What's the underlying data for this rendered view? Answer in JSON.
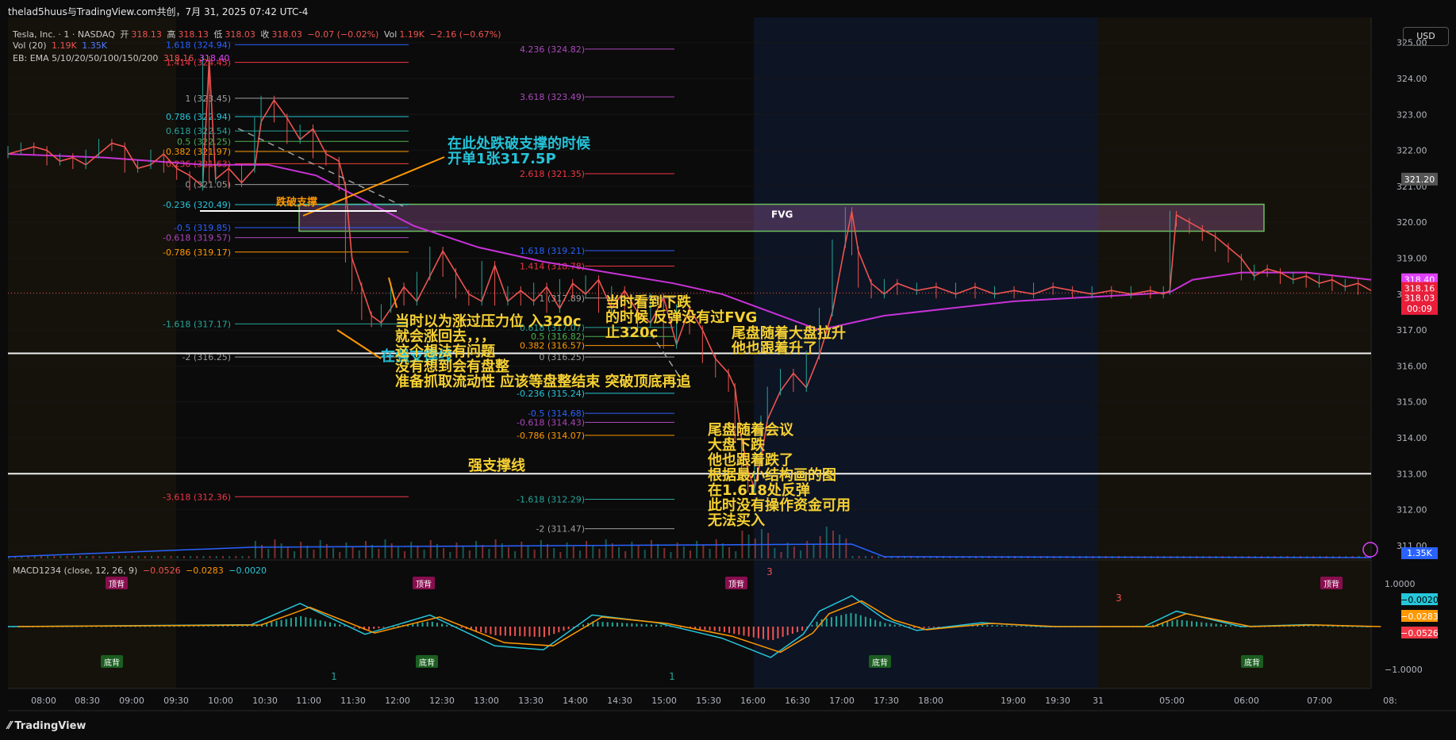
{
  "header": {
    "title": "thelad5huus与TradingView.com共创，7月 31, 2025 07:42 UTC-4"
  },
  "legend": {
    "symbol": "Tesla, Inc. · 1 · NASDAQ",
    "open_label": "开",
    "open": "318.13",
    "high_label": "高",
    "high": "318.13",
    "low_label": "低",
    "low": "318.03",
    "close_label": "收",
    "close": "318.03",
    "change": "−0.07 (−0.02%)",
    "vol_label": "Vol",
    "vol": "1.19K",
    "vol_change": "−2.16 (−0.67%)",
    "vol20_label": "Vol (20)",
    "vol20_a": "1.19K",
    "vol20_b": "1.35K",
    "ema_label": "EB: EMA 5/10/20/50/100/150/200",
    "ema_a": "318.16",
    "ema_b": "318.40",
    "macd_label": "MACD1234 (close, 12, 26, 9)",
    "macd_a": "−0.0526",
    "macd_b": "−0.0283",
    "macd_c": "−0.0020"
  },
  "currency": "USD",
  "footer": {
    "brand": "TradingView"
  },
  "colors": {
    "bg": "#0b0b0b",
    "price": "#ef5350",
    "up": "#26a69a",
    "ema": "#c832d8",
    "fvg": "#6abf5e"
  },
  "chart_data": {
    "type": "line",
    "x_ticks": [
      "08:00",
      "08:30",
      "09:00",
      "09:30",
      "10:00",
      "10:30",
      "11:00",
      "11:30",
      "12:00",
      "12:30",
      "13:00",
      "13:30",
      "14:00",
      "14:30",
      "15:00",
      "15:30",
      "16:00",
      "16:30",
      "17:00",
      "17:30",
      "18:00",
      "19:00",
      "19:30",
      "31",
      "05:00",
      "06:00",
      "07:00",
      "08:"
    ],
    "y_ticks": [
      "325.00",
      "324.00",
      "323.00",
      "322.00",
      "321.00",
      "320.00",
      "319.00",
      "318.00",
      "317.00",
      "316.00",
      "315.00",
      "314.00",
      "313.00",
      "312.00",
      "311.00"
    ],
    "ylim": [
      310.6,
      325.7
    ],
    "price_labels": [
      {
        "text": "321.20",
        "y": 321.2,
        "color": "#555555"
      },
      {
        "text": "318.40",
        "y": 318.4,
        "color": "#e040fb"
      },
      {
        "text": "318.16",
        "y": 318.16,
        "color": "#e91e3a"
      },
      {
        "text": "318.03",
        "y": 317.9,
        "color": "#e91e3a"
      },
      {
        "text": "00:09",
        "y": 317.6,
        "color": "#e91e3a"
      }
    ],
    "vol_label": "1.35K",
    "price_series": [
      [
        0,
        321.9
      ],
      [
        8,
        322.0
      ],
      [
        16,
        322.1
      ],
      [
        24,
        322.0
      ],
      [
        32,
        321.7
      ],
      [
        40,
        321.8
      ],
      [
        48,
        321.6
      ],
      [
        56,
        321.9
      ],
      [
        64,
        322.2
      ],
      [
        72,
        322.1
      ],
      [
        80,
        321.5
      ],
      [
        88,
        321.6
      ],
      [
        96,
        321.9
      ],
      [
        104,
        321.5
      ],
      [
        112,
        321.3
      ],
      [
        120,
        321.0
      ],
      [
        124,
        324.5
      ],
      [
        128,
        321.2
      ],
      [
        136,
        321.5
      ],
      [
        144,
        321.1
      ],
      [
        152,
        321.5
      ],
      [
        156,
        322.8
      ],
      [
        164,
        323.4
      ],
      [
        172,
        322.9
      ],
      [
        180,
        322.3
      ],
      [
        188,
        322.6
      ],
      [
        196,
        321.9
      ],
      [
        204,
        321.7
      ],
      [
        208,
        321.0
      ],
      [
        212,
        319.0
      ],
      [
        218,
        318.2
      ],
      [
        224,
        317.4
      ],
      [
        230,
        317.2
      ],
      [
        236,
        317.6
      ],
      [
        244,
        318.2
      ],
      [
        252,
        317.8
      ],
      [
        260,
        318.5
      ],
      [
        268,
        319.2
      ],
      [
        276,
        318.6
      ],
      [
        284,
        318.0
      ],
      [
        292,
        317.8
      ],
      [
        300,
        318.8
      ],
      [
        308,
        317.8
      ],
      [
        316,
        318.1
      ],
      [
        324,
        317.8
      ],
      [
        332,
        318.2
      ],
      [
        340,
        317.6
      ],
      [
        348,
        318.3
      ],
      [
        356,
        318.0
      ],
      [
        364,
        318.4
      ],
      [
        372,
        317.6
      ],
      [
        380,
        318.1
      ],
      [
        388,
        317.5
      ],
      [
        396,
        317.2
      ],
      [
        404,
        317.9
      ],
      [
        412,
        316.6
      ],
      [
        420,
        317.6
      ],
      [
        428,
        317.0
      ],
      [
        436,
        316.2
      ],
      [
        444,
        315.8
      ],
      [
        448,
        315.4
      ],
      [
        452,
        314.0
      ],
      [
        456,
        313.1
      ],
      [
        460,
        312.6
      ],
      [
        464,
        313.4
      ],
      [
        468,
        314.5
      ],
      [
        476,
        315.3
      ],
      [
        484,
        315.8
      ],
      [
        492,
        315.4
      ],
      [
        500,
        316.3
      ],
      [
        508,
        317.5
      ],
      [
        516,
        319.4
      ],
      [
        520,
        320.3
      ],
      [
        524,
        319.2
      ],
      [
        532,
        318.3
      ],
      [
        540,
        318.0
      ],
      [
        548,
        318.3
      ],
      [
        560,
        318.1
      ],
      [
        572,
        318.2
      ],
      [
        584,
        318.0
      ],
      [
        596,
        318.2
      ],
      [
        608,
        318.0
      ],
      [
        620,
        318.1
      ],
      [
        632,
        318.0
      ],
      [
        644,
        318.2
      ],
      [
        656,
        318.1
      ],
      [
        668,
        318.0
      ],
      [
        680,
        318.1
      ],
      [
        692,
        318.0
      ],
      [
        704,
        318.1
      ],
      [
        712,
        318.0
      ],
      [
        716,
        318.1
      ],
      [
        720,
        320.2
      ],
      [
        728,
        320.0
      ],
      [
        736,
        319.8
      ],
      [
        744,
        319.6
      ],
      [
        752,
        319.3
      ],
      [
        760,
        319.0
      ],
      [
        768,
        318.5
      ],
      [
        776,
        318.7
      ],
      [
        784,
        318.6
      ],
      [
        792,
        318.4
      ],
      [
        800,
        318.5
      ],
      [
        808,
        318.3
      ],
      [
        816,
        318.4
      ],
      [
        824,
        318.2
      ],
      [
        832,
        318.3
      ],
      [
        840,
        318.1
      ]
    ],
    "ema_series": [
      [
        0,
        321.9
      ],
      [
        60,
        321.8
      ],
      [
        120,
        321.6
      ],
      [
        160,
        321.6
      ],
      [
        190,
        321.3
      ],
      [
        220,
        320.6
      ],
      [
        250,
        319.9
      ],
      [
        290,
        319.3
      ],
      [
        330,
        318.9
      ],
      [
        370,
        318.6
      ],
      [
        410,
        318.3
      ],
      [
        440,
        318.0
      ],
      [
        470,
        317.5
      ],
      [
        500,
        317.0
      ],
      [
        520,
        317.2
      ],
      [
        540,
        317.4
      ],
      [
        580,
        317.6
      ],
      [
        620,
        317.8
      ],
      [
        660,
        317.9
      ],
      [
        700,
        318.0
      ],
      [
        716,
        318.05
      ],
      [
        730,
        318.4
      ],
      [
        760,
        318.6
      ],
      [
        800,
        318.6
      ],
      [
        840,
        318.4
      ]
    ],
    "fvg_zone": {
      "label": "FVG",
      "y_top": 320.5,
      "y_bottom": 319.75
    },
    "support_lines": [
      316.35,
      313.0
    ],
    "fib_sets": [
      {
        "levels": [
          {
            "text": "1.618 (324.94)",
            "y": 324.94,
            "color": "#2962ff"
          },
          {
            "text": "1.414 (324.45)",
            "y": 324.45,
            "color": "#f23645"
          },
          {
            "text": "1 (323.45)",
            "y": 323.45,
            "color": "#9e9e9e"
          },
          {
            "text": "0.786 (322.94)",
            "y": 322.94,
            "color": "#26c6da"
          },
          {
            "text": "0.618 (322.54)",
            "y": 322.54,
            "color": "#26a69a"
          },
          {
            "text": "0.5 (322.25)",
            "y": 322.25,
            "color": "#4caf50"
          },
          {
            "text": "0.382 (321.97)",
            "y": 321.97,
            "color": "#ff9800"
          },
          {
            "text": "0.236 (321.63)",
            "y": 321.63,
            "color": "#f44336"
          },
          {
            "text": "0 (321.05)",
            "y": 321.05,
            "color": "#9e9e9e"
          },
          {
            "text": "-0.236 (320.49)",
            "y": 320.49,
            "color": "#26c6da"
          },
          {
            "text": "-0.5 (319.85)",
            "y": 319.85,
            "color": "#2962ff"
          },
          {
            "text": "-0.618 (319.57)",
            "y": 319.57,
            "color": "#ab47bc"
          },
          {
            "text": "-0.786 (319.17)",
            "y": 319.17,
            "color": "#ff9800"
          },
          {
            "text": "-1.618 (317.17)",
            "y": 317.17,
            "color": "#26a69a"
          },
          {
            "text": "-2 (316.25)",
            "y": 316.25,
            "color": "#9e9e9e"
          },
          {
            "text": "-3.618 (312.36)",
            "y": 312.36,
            "color": "#f23645"
          }
        ]
      },
      {
        "levels": [
          {
            "text": "4.236 (324.82)",
            "y": 324.82,
            "color": "#ab47bc"
          },
          {
            "text": "3.618 (323.49)",
            "y": 323.49,
            "color": "#ab47bc"
          },
          {
            "text": "2.618 (321.35)",
            "y": 321.35,
            "color": "#f23645"
          },
          {
            "text": "1.618 (319.21)",
            "y": 319.21,
            "color": "#2962ff"
          },
          {
            "text": "1.414 (318.78)",
            "y": 318.78,
            "color": "#f23645"
          },
          {
            "text": "1 (317.89)",
            "y": 317.89,
            "color": "#9e9e9e"
          },
          {
            "text": "0.618 (317.07)",
            "y": 317.07,
            "color": "#26a69a"
          },
          {
            "text": "0.5 (316.82)",
            "y": 316.82,
            "color": "#4caf50"
          },
          {
            "text": "0.382 (316.57)",
            "y": 316.57,
            "color": "#ff9800"
          },
          {
            "text": "0 (316.25)",
            "y": 316.25,
            "color": "#9e9e9e"
          },
          {
            "text": "-0.236 (315.24)",
            "y": 315.24,
            "color": "#26c6da"
          },
          {
            "text": "-0.5 (314.68)",
            "y": 314.68,
            "color": "#2962ff"
          },
          {
            "text": "-0.618 (314.43)",
            "y": 314.43,
            "color": "#ab47bc"
          },
          {
            "text": "-0.786 (314.07)",
            "y": 314.07,
            "color": "#ff9800"
          },
          {
            "text": "-1.618 (312.29)",
            "y": 312.29,
            "color": "#26a69a"
          },
          {
            "text": "-2 (311.47)",
            "y": 311.47,
            "color": "#9e9e9e"
          }
        ]
      }
    ],
    "macd": {
      "y_ticks": [
        "1.0000",
        "−1.0000"
      ],
      "labels": [
        {
          "text": "−0.0020",
          "color": "#26c6da"
        },
        {
          "text": "−0.0283",
          "color": "#ff9800"
        },
        {
          "text": "−0.0526",
          "color": "#f23645"
        }
      ],
      "divergence_tags": [
        {
          "text": "顶背",
          "color": "#880e4f"
        },
        {
          "text": "顶背",
          "color": "#880e4f"
        },
        {
          "text": "顶背",
          "color": "#880e4f"
        },
        {
          "text": "顶背",
          "color": "#880e4f"
        },
        {
          "text": "底背",
          "color": "#1b5e20"
        },
        {
          "text": "底背",
          "color": "#1b5e20"
        },
        {
          "text": "底背",
          "color": "#1b5e20"
        },
        {
          "text": "底背",
          "color": "#1b5e20"
        }
      ],
      "count_marks": [
        "3",
        "1",
        "3",
        "1"
      ]
    }
  },
  "annotations": {
    "entry": "在此处跌破支撑的时候\n开单1张317.5P",
    "break_support": "跌破支撑",
    "mistake": "当时以为涨过压力位 入320c\n就会涨回去，，，\n这个想法有问题\n没有想到会有盘整\n准备抓取流动性 应该等盘整结束 突破顶底再追",
    "stop": "当时看到下跌\n的时候 反弹没有过FVG\n止320c",
    "close_rally": "尾盘随着大盘拉升\n他也跟着升了",
    "close_drop": "尾盘随着会议\n大盘下跌\n他也跟着跌了\n根据最小结构画的图\n在1.618处反弹\n此时没有操作资金可用\n无法买入",
    "strong_support": "强支撑线",
    "support_partial": "在强支撑线"
  }
}
